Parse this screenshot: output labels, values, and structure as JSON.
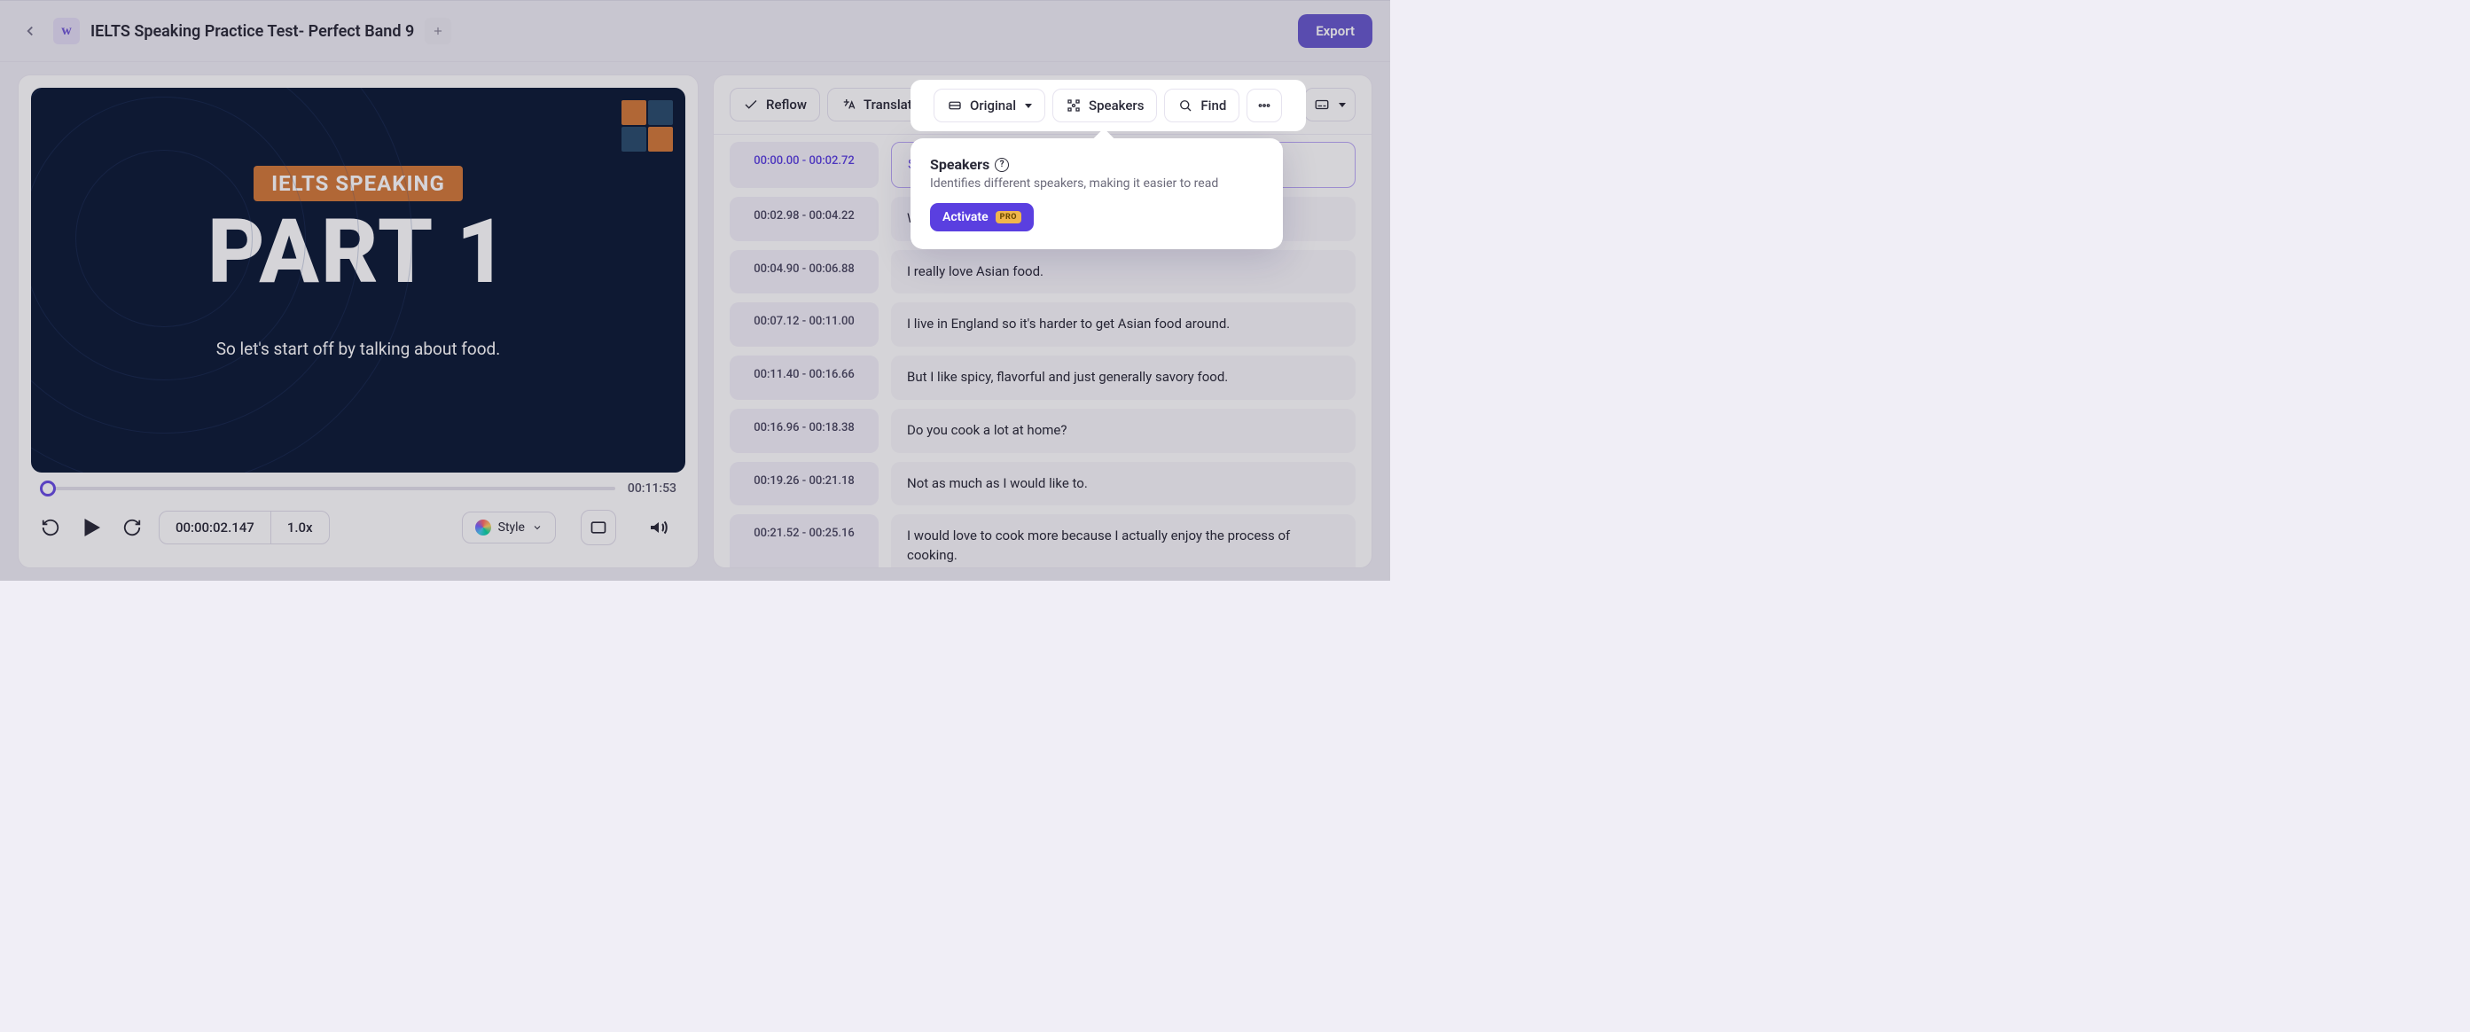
{
  "header": {
    "title": "IELTS Speaking Practice Test- Perfect Band 9",
    "export_label": "Export"
  },
  "video": {
    "badge": "IELTS SPEAKING",
    "big_text": "PART 1",
    "subtitle": "So let's start off by talking about food.",
    "duration": "00:11:53",
    "current_time": "00:00:02.147",
    "speed": "1.0x",
    "style_label": "Style"
  },
  "toolbar": {
    "reflow": "Reflow",
    "translate": "Translate",
    "original": "Original",
    "speakers": "Speakers",
    "find": "Find"
  },
  "popover": {
    "title": "Speakers",
    "desc": "Identifies different speakers, making it easier to read",
    "activate_label": "Activate",
    "pro_label": "PRO"
  },
  "transcript": [
    {
      "start": "00:00.00",
      "end": "00:02.72",
      "text": "So let",
      "active": true
    },
    {
      "start": "00:02.98",
      "end": "00:04.22",
      "text": "What'"
    },
    {
      "start": "00:04.90",
      "end": "00:06.88",
      "text": "I really love Asian food."
    },
    {
      "start": "00:07.12",
      "end": "00:11.00",
      "text": "I live in England so it's harder to get Asian food around."
    },
    {
      "start": "00:11.40",
      "end": "00:16.66",
      "text": "But I like spicy, flavorful and just generally savory food."
    },
    {
      "start": "00:16.96",
      "end": "00:18.38",
      "text": "Do you cook a lot at home?"
    },
    {
      "start": "00:19.26",
      "end": "00:21.18",
      "text": "Not as much as I would like to."
    },
    {
      "start": "00:21.52",
      "end": "00:25.16",
      "text": "I would love to cook more because I actually enjoy the process of cooking."
    }
  ]
}
